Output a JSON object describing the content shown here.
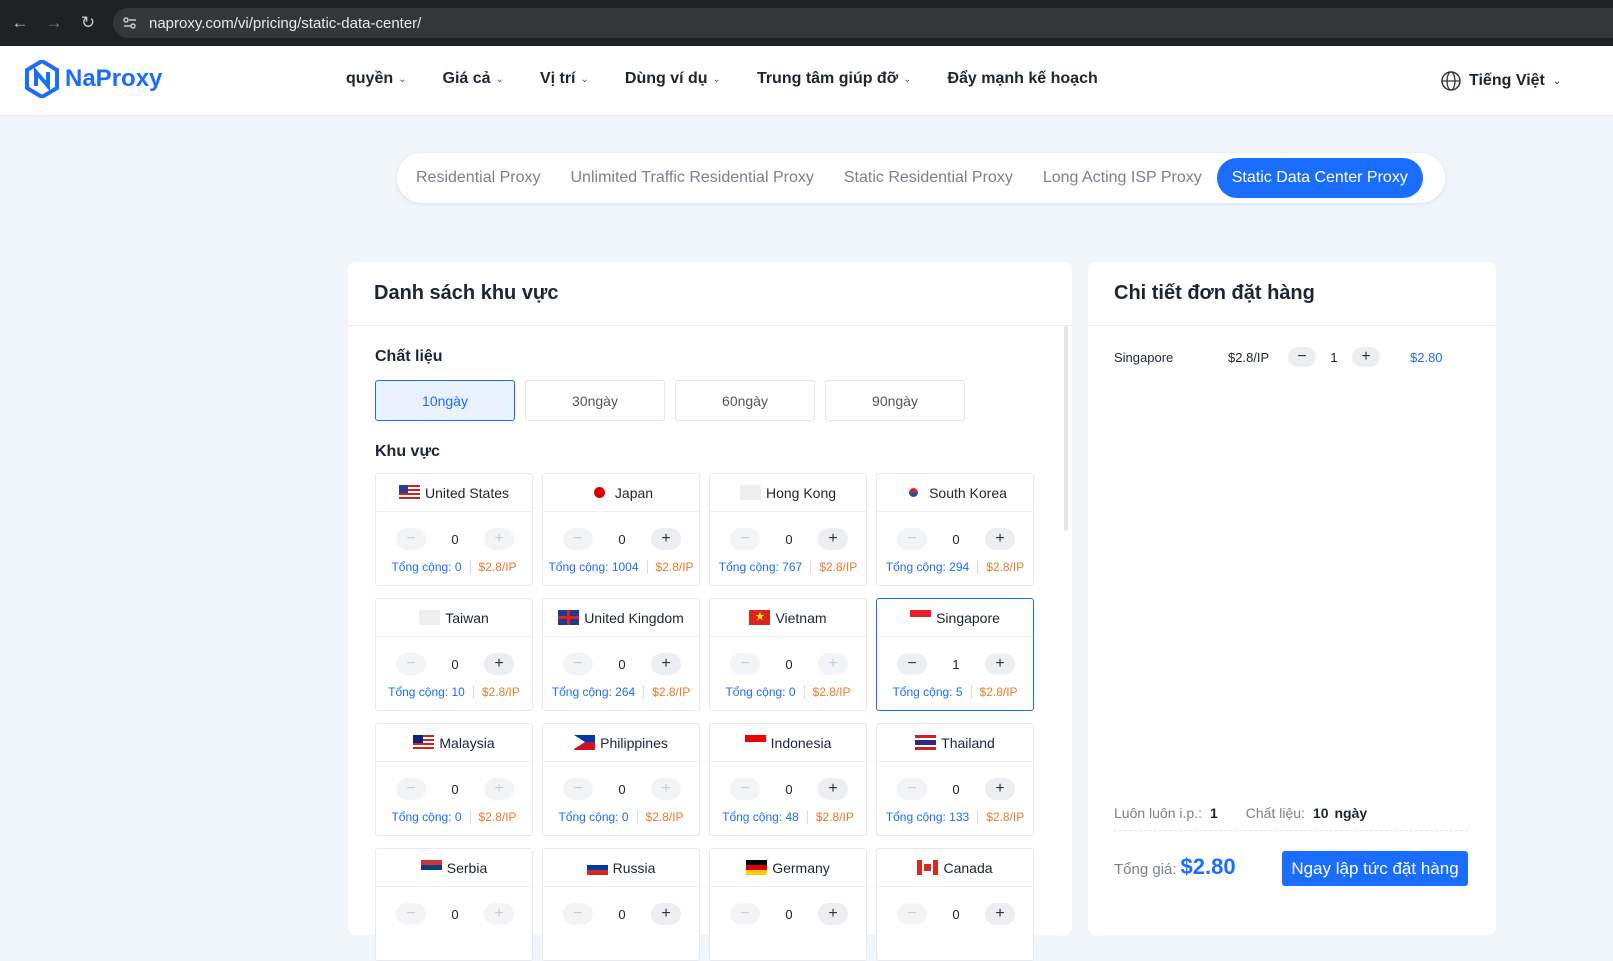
{
  "browser": {
    "url": "naproxy.com/vi/pricing/static-data-center/"
  },
  "brand": {
    "name": "NaProxy"
  },
  "nav": {
    "items": [
      {
        "label": "quyền",
        "dropdown": true
      },
      {
        "label": "Giá cả",
        "dropdown": true
      },
      {
        "label": "Vị trí",
        "dropdown": true
      },
      {
        "label": "Dùng ví dụ",
        "dropdown": true
      },
      {
        "label": "Trung tâm giúp đỡ",
        "dropdown": true
      },
      {
        "label": "Đẩy mạnh kế hoạch",
        "dropdown": false
      }
    ],
    "language": "Tiếng Việt"
  },
  "tabs": [
    {
      "label": "Residential Proxy",
      "active": false
    },
    {
      "label": "Unlimited Traffic Residential Proxy",
      "active": false
    },
    {
      "label": "Static Residential Proxy",
      "active": false
    },
    {
      "label": "Long Acting ISP Proxy",
      "active": false
    },
    {
      "label": "Static Data Center Proxy",
      "active": true
    }
  ],
  "region_panel": {
    "title": "Danh sách khu vực",
    "duration_label": "Chất liệu",
    "durations": [
      {
        "label": "10ngày",
        "selected": true
      },
      {
        "label": "30ngày",
        "selected": false
      },
      {
        "label": "60ngày",
        "selected": false
      },
      {
        "label": "90ngày",
        "selected": false
      }
    ],
    "region_label": "Khu vực",
    "regions": [
      {
        "name": "United States",
        "flag": "us-flag",
        "qty": "0",
        "total": "Tổng cộng: 0",
        "price": "$2.8/IP",
        "minus": false,
        "plus": false,
        "selected": false
      },
      {
        "name": "Japan",
        "flag": "jp-flag",
        "qty": "0",
        "total": "Tổng cộng: 1004",
        "price": "$2.8/IP",
        "minus": false,
        "plus": true,
        "selected": false
      },
      {
        "name": "Hong Kong",
        "flag": "hk-flag",
        "qty": "0",
        "total": "Tổng cộng: 767",
        "price": "$2.8/IP",
        "minus": false,
        "plus": true,
        "selected": false
      },
      {
        "name": "South Korea",
        "flag": "kr-flag",
        "qty": "0",
        "total": "Tổng cộng: 294",
        "price": "$2.8/IP",
        "minus": false,
        "plus": true,
        "selected": false
      },
      {
        "name": "Taiwan",
        "flag": "tw-flag",
        "qty": "0",
        "total": "Tổng cộng: 10",
        "price": "$2.8/IP",
        "minus": false,
        "plus": true,
        "selected": false
      },
      {
        "name": "United Kingdom",
        "flag": "gb-flag",
        "qty": "0",
        "total": "Tổng cộng: 264",
        "price": "$2.8/IP",
        "minus": false,
        "plus": true,
        "selected": false
      },
      {
        "name": "Vietnam",
        "flag": "vn-flag",
        "qty": "0",
        "total": "Tổng cộng: 0",
        "price": "$2.8/IP",
        "minus": false,
        "plus": false,
        "selected": false
      },
      {
        "name": "Singapore",
        "flag": "sg-flag",
        "qty": "1",
        "total": "Tổng cộng: 5",
        "price": "$2.8/IP",
        "minus": true,
        "plus": true,
        "selected": true
      },
      {
        "name": "Malaysia",
        "flag": "my-flag",
        "qty": "0",
        "total": "Tổng cộng: 0",
        "price": "$2.8/IP",
        "minus": false,
        "plus": false,
        "selected": false
      },
      {
        "name": "Philippines",
        "flag": "ph-flag",
        "qty": "0",
        "total": "Tổng cộng: 0",
        "price": "$2.8/IP",
        "minus": false,
        "plus": false,
        "selected": false
      },
      {
        "name": "Indonesia",
        "flag": "id-flag",
        "qty": "0",
        "total": "Tổng cộng: 48",
        "price": "$2.8/IP",
        "minus": false,
        "plus": true,
        "selected": false
      },
      {
        "name": "Thailand",
        "flag": "th-flag",
        "qty": "0",
        "total": "Tổng cộng: 133",
        "price": "$2.8/IP",
        "minus": false,
        "plus": true,
        "selected": false
      },
      {
        "name": "Serbia",
        "flag": "rs-flag",
        "qty": "0",
        "total": "",
        "price": "",
        "minus": false,
        "plus": false,
        "selected": false
      },
      {
        "name": "Russia",
        "flag": "ru-flag",
        "qty": "0",
        "total": "",
        "price": "",
        "minus": false,
        "plus": true,
        "selected": false
      },
      {
        "name": "Germany",
        "flag": "de-flag",
        "qty": "0",
        "total": "",
        "price": "",
        "minus": false,
        "plus": true,
        "selected": false
      },
      {
        "name": "Canada",
        "flag": "ca-flag",
        "qty": "0",
        "total": "",
        "price": "",
        "minus": false,
        "plus": true,
        "selected": false
      }
    ]
  },
  "order": {
    "title": "Chi tiết đơn đặt hàng",
    "items": [
      {
        "region": "Singapore",
        "unit_price": "$2.8/IP",
        "qty": "1",
        "subtotal": "$2.80"
      }
    ],
    "ip_label": "Luôn luôn i.p.:",
    "ip_value": "1",
    "duration_label": "Chất liệu:",
    "duration_value": "10",
    "duration_unit": "ngày",
    "total_label": "Tổng giá:",
    "total_value": "$2.80",
    "button": "Ngay lập tức đặt hàng"
  },
  "colors": {
    "accent": "#1a6dff",
    "price": "#f07a2a"
  }
}
